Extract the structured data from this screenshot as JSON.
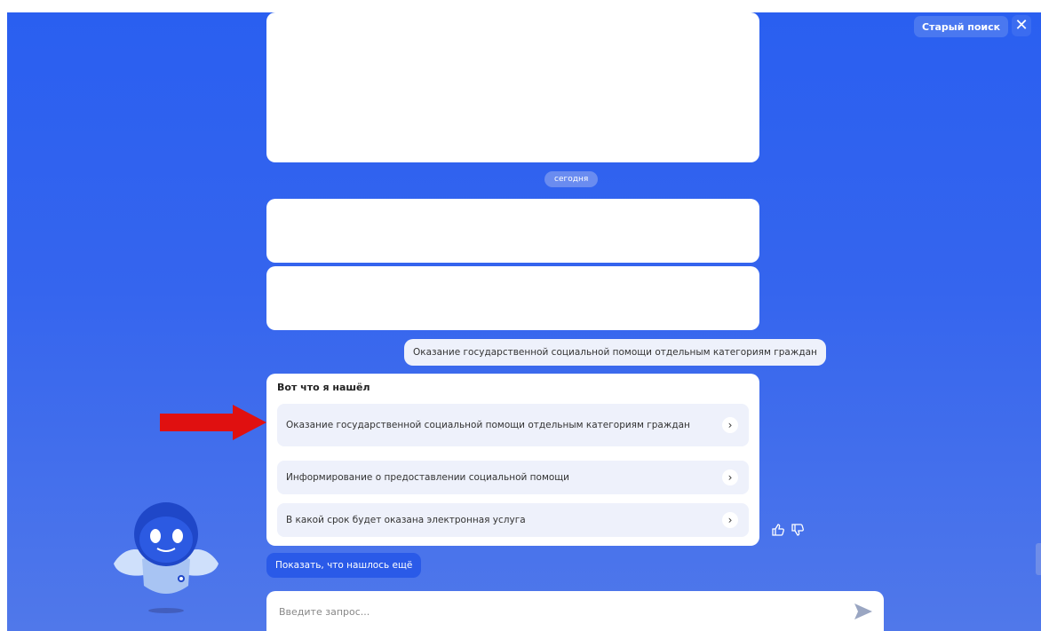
{
  "header": {
    "old_search_label": "Старый поиск",
    "close_glyph": "✕"
  },
  "chat": {
    "date_chip": "сегодня",
    "user_message": "Оказание государственной социальной помощи отдельным категориям граждан",
    "results": {
      "title": "Вот что я нашёл",
      "items": [
        {
          "label": "Оказание государственной социальной помощи отдельным категориям граждан"
        },
        {
          "label": "Информирование о предоставлении социальной помощи"
        },
        {
          "label": "В какой срок будет оказана электронная услуга"
        }
      ],
      "chevron_glyph": "›"
    },
    "feedback": {
      "like_icon": "thumbs-up-icon",
      "dislike_icon": "thumbs-down-icon"
    },
    "show_more_label": "Показать, что нашлось ещё"
  },
  "input": {
    "placeholder": "Введите запрос..."
  },
  "colors": {
    "background_top": "#2a5ff0",
    "background_bottom": "#5078ea",
    "annotation_arrow": "#e01010"
  }
}
